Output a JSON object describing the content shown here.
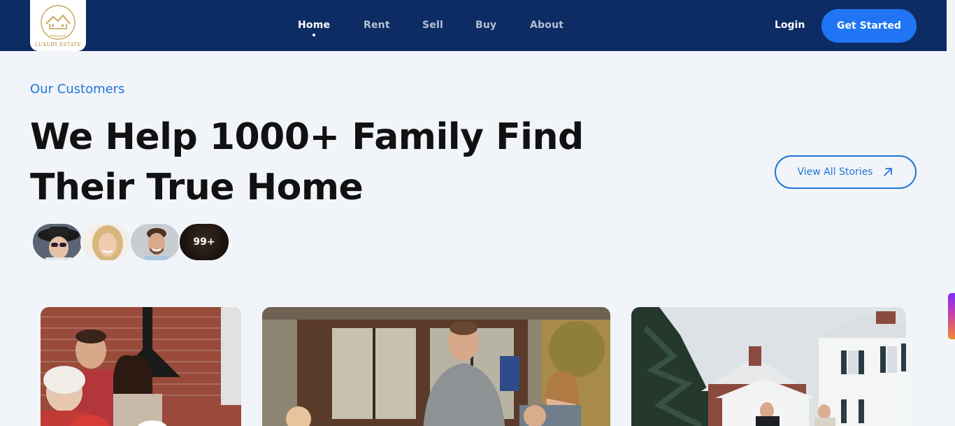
{
  "brand": {
    "logo_text": "LUXURY ESTATE",
    "name": "Luxury Estate"
  },
  "nav": {
    "items": [
      {
        "label": "Home",
        "active": true
      },
      {
        "label": "Rent",
        "active": false
      },
      {
        "label": "Sell",
        "active": false
      },
      {
        "label": "Buy",
        "active": false
      },
      {
        "label": "About",
        "active": false
      }
    ],
    "login_label": "Login",
    "cta_label": "Get Started"
  },
  "hero": {
    "eyebrow": "Our Customers",
    "headline_line1": "We Help 1000+ Family Find",
    "headline_line2": "Their True Home",
    "view_all_label": "View All Stories",
    "customer_count_badge": "99+"
  },
  "colors": {
    "nav_bg": "#0d2c64",
    "accent": "#2075f5",
    "accent_text": "#2075d8",
    "page_bg": "#f1f4f9"
  },
  "icons": {
    "view_all": "arrow-up-right-icon"
  }
}
